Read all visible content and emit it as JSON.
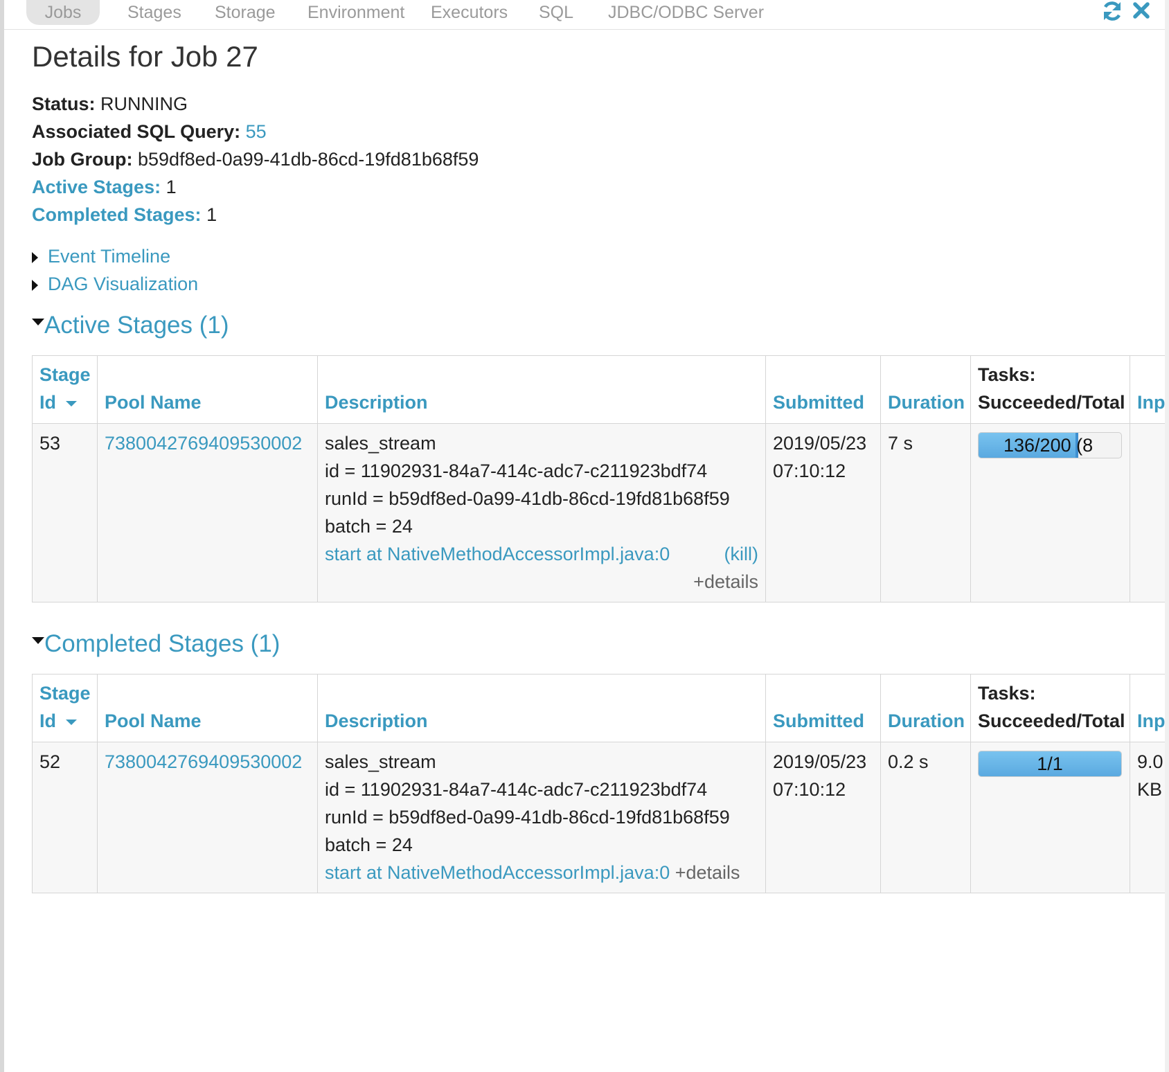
{
  "nav": {
    "tabs": [
      "Jobs",
      "Stages",
      "Storage",
      "Environment",
      "Executors",
      "SQL",
      "JDBC/ODBC Server"
    ],
    "active_tab": "Jobs",
    "refresh_icon": "refresh-icon",
    "close_icon": "close-icon"
  },
  "page": {
    "title": "Details for Job 27"
  },
  "summary": {
    "status_label": "Status:",
    "status_value": "RUNNING",
    "sql_label": "Associated SQL Query:",
    "sql_value": "55",
    "group_label": "Job Group:",
    "group_value": "b59df8ed-0a99-41db-86cd-19fd81b68f59",
    "active_label": "Active Stages:",
    "active_value": "1",
    "completed_label": "Completed Stages:",
    "completed_value": "1"
  },
  "toggles": {
    "event_timeline": "Event Timeline",
    "dag_visualization": "DAG Visualization"
  },
  "table_headers": {
    "stage_id_1": "Stage",
    "stage_id_2": "Id",
    "pool_name": "Pool Name",
    "description": "Description",
    "submitted": "Submitted",
    "duration": "Duration",
    "tasks_1": "Tasks:",
    "tasks_2": "Succeeded/Total",
    "input": "Inp"
  },
  "active_stages": {
    "heading": "Active Stages (1)",
    "rows": [
      {
        "stage_id": "53",
        "pool_name": "7380042769409530002",
        "desc_name": "sales_stream",
        "desc_id": "id = 11902931-84a7-414c-adc7-c211923bdf74",
        "desc_runid": "runId = b59df8ed-0a99-41db-86cd-19fd81b68f59",
        "desc_batch": "batch = 24",
        "desc_link": "start at NativeMethodAccessorImpl.java:0",
        "kill": "(kill)",
        "details": "+details",
        "submitted_date": "2019/05/23",
        "submitted_time": "07:10:12",
        "duration": "7 s",
        "tasks_text": "136/200 (8",
        "tasks_fraction": 0.68,
        "input": ""
      }
    ]
  },
  "completed_stages": {
    "heading": "Completed Stages (1)",
    "rows": [
      {
        "stage_id": "52",
        "pool_name": "7380042769409530002",
        "desc_name": "sales_stream",
        "desc_id": "id = 11902931-84a7-414c-adc7-c211923bdf74",
        "desc_runid": "runId = b59df8ed-0a99-41db-86cd-19fd81b68f59",
        "desc_batch": "batch = 24",
        "desc_link": "start at NativeMethodAccessorImpl.java:0",
        "details": "+details",
        "submitted_date": "2019/05/23",
        "submitted_time": "07:10:12",
        "duration": "0.2 s",
        "tasks_text": "1/1",
        "tasks_fraction": 1.0,
        "input_1": "9.0",
        "input_2": "KB"
      }
    ]
  },
  "colors": {
    "link": "#3a99bf",
    "progress_fill": "#5aa9e0"
  }
}
